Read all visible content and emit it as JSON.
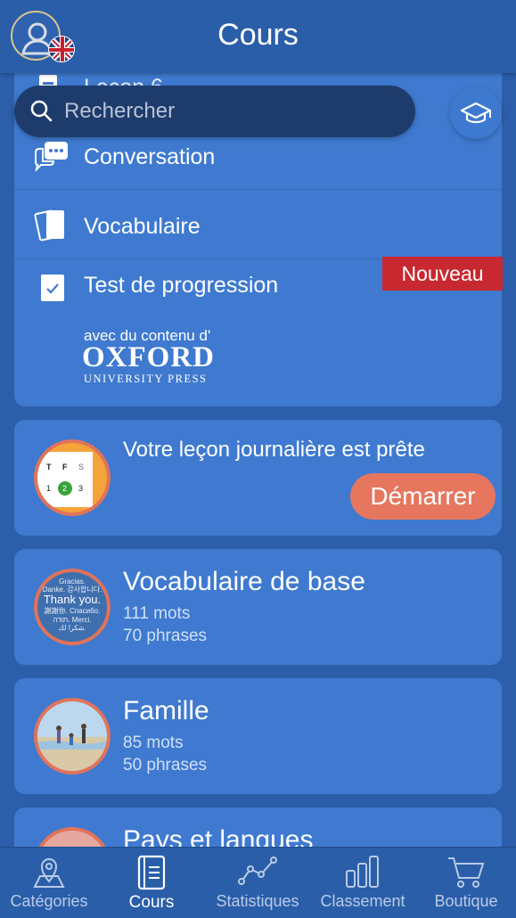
{
  "header": {
    "title": "Cours"
  },
  "search": {
    "placeholder": "Rechercher"
  },
  "top_card": {
    "partial_row": "Leçon 6",
    "rows": [
      {
        "label": "Conversation"
      },
      {
        "label": "Vocabulaire"
      },
      {
        "label": "Test de progression"
      }
    ],
    "badge": "Nouveau",
    "oxford_pre": "avec du contenu d'",
    "oxford_main": "OXFORD",
    "oxford_sub": "UNIVERSITY PRESS"
  },
  "daily": {
    "title": "Votre leçon journalière est prête",
    "button": "Démarrer",
    "calendar": {
      "days": [
        "T",
        "F",
        "S"
      ],
      "dates": [
        "1",
        "2",
        "3"
      ]
    }
  },
  "courses": [
    {
      "title": "Vocabulaire de base",
      "words": "111 mots",
      "phrases": "70 phrases",
      "thumb_text": [
        "Gracias.",
        "Danke. 감사합니다.",
        "Thank you.",
        "謝謝你. Спасибо.",
        "תודה. Merci.",
        "شكرا لك."
      ]
    },
    {
      "title": "Famille",
      "words": "85 mots",
      "phrases": "50 phrases"
    },
    {
      "title": "Pays et langues"
    }
  ],
  "tabbar": [
    {
      "label": "Catégories",
      "icon": "map-icon"
    },
    {
      "label": "Cours",
      "icon": "book-icon",
      "active": true
    },
    {
      "label": "Statistiques",
      "icon": "line-chart-icon"
    },
    {
      "label": "Classement",
      "icon": "bar-chart-icon"
    },
    {
      "label": "Boutique",
      "icon": "cart-icon"
    }
  ],
  "colors": {
    "background": "#2c5eaa",
    "card": "#3f7ad0",
    "accent": "#e6775e",
    "badge": "#c8282f",
    "search": "#1e3c6b"
  }
}
